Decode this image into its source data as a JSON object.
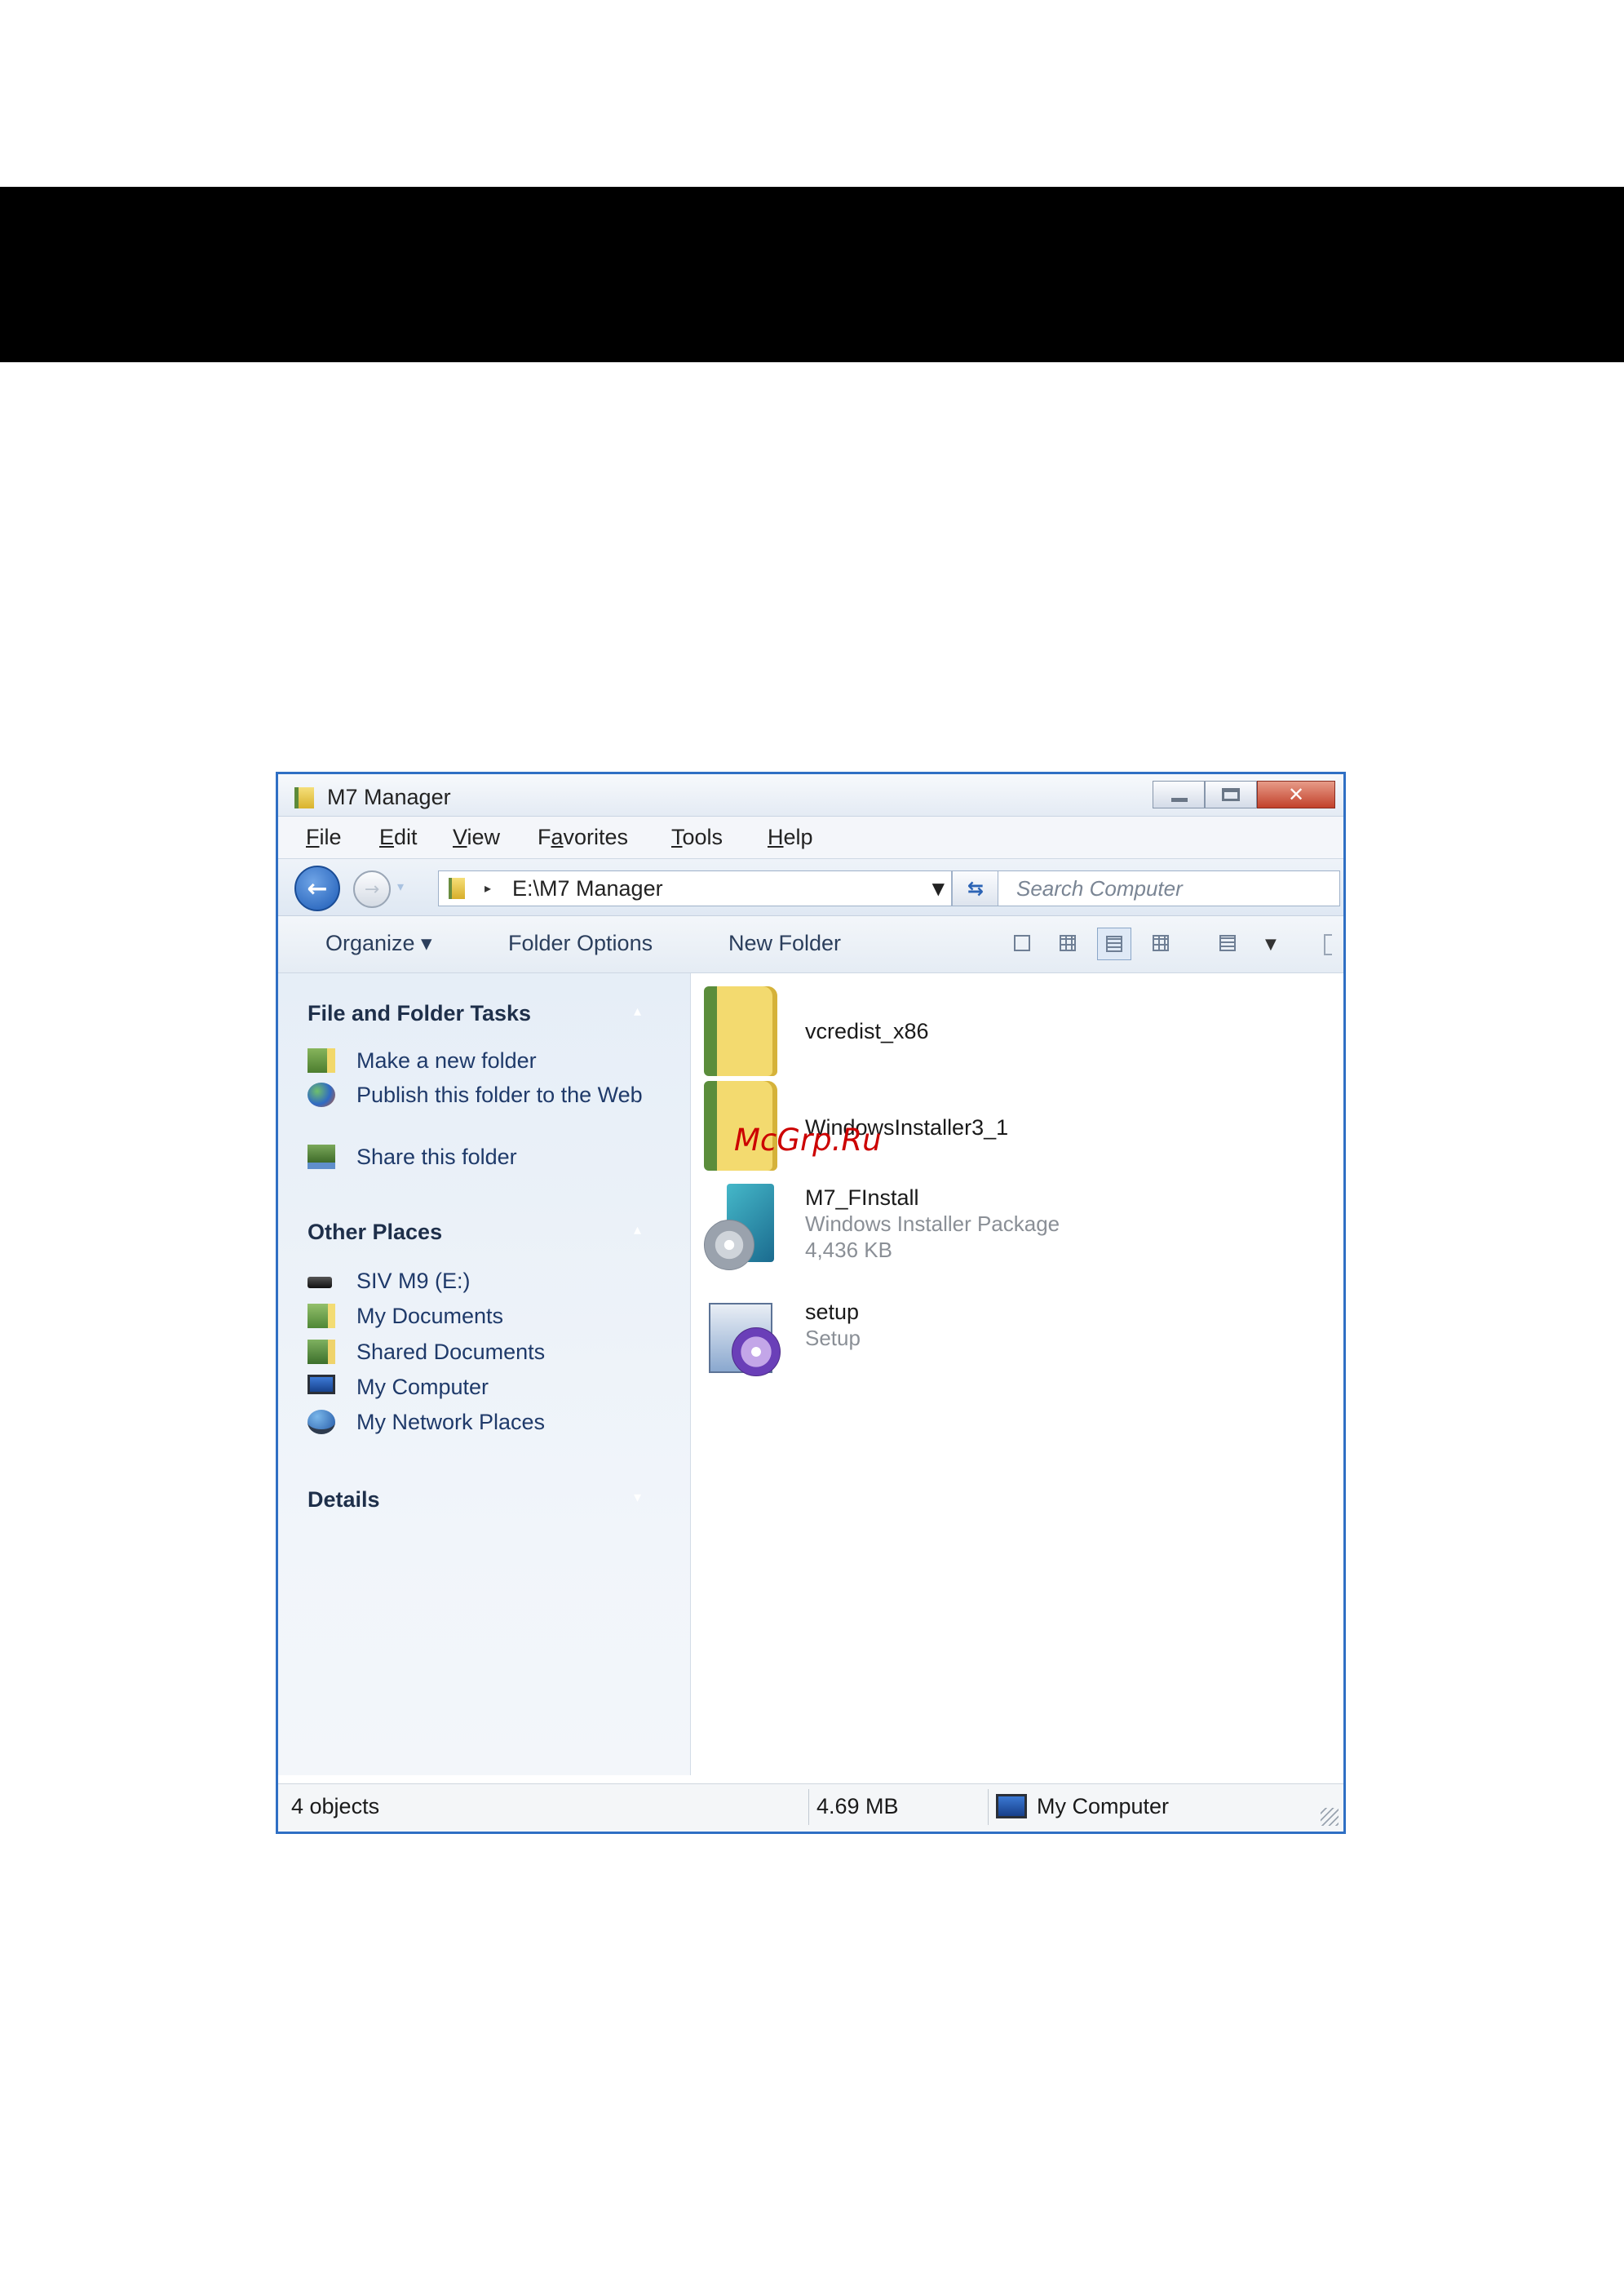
{
  "watermark": "McGrp.Ru",
  "window": {
    "title": "M7 Manager",
    "controls": {
      "minimize": "minimize-icon",
      "maximize": "maximize-icon",
      "close": "✕"
    }
  },
  "menu": {
    "file": {
      "mn": "F",
      "rest": "ile"
    },
    "edit": {
      "mn": "E",
      "rest": "dit"
    },
    "view": {
      "mn": "V",
      "rest": "iew"
    },
    "favorites": {
      "pre": "F",
      "mn": "a",
      "rest": "vorites"
    },
    "tools": {
      "mn": "T",
      "rest": "ools"
    },
    "help": {
      "mn": "H",
      "rest": "elp"
    }
  },
  "address": {
    "path": "E:\\M7 Manager",
    "search_placeholder": "Search Computer"
  },
  "toolbar": {
    "organize": "Organize ▾",
    "folder_options": "Folder Options",
    "new_folder": "New Folder"
  },
  "sidebar": {
    "tasks_heading": "File and Folder Tasks",
    "tasks": [
      "Make a new folder",
      "Publish this folder to the Web",
      "Share this folder"
    ],
    "places_heading": "Other Places",
    "places": [
      "SIV M9 (E:)",
      "My Documents",
      "Shared Documents",
      "My Computer",
      "My Network Places"
    ],
    "details_heading": "Details"
  },
  "files": [
    {
      "name": "vcredist_x86"
    },
    {
      "name": "WindowsInstaller3_1"
    },
    {
      "name": "M7_FInstall",
      "type": "Windows Installer Package",
      "size": "4,436 KB"
    },
    {
      "name": "setup",
      "type": "Setup"
    }
  ],
  "status": {
    "objects": "4 objects",
    "size": "4.69 MB",
    "location": "My Computer"
  },
  "colors": {
    "window_border": "#2f6fc4",
    "sidebar_bg": "#e6eef7",
    "link_text": "#1f3a6a",
    "watermark": "#cc0000"
  }
}
